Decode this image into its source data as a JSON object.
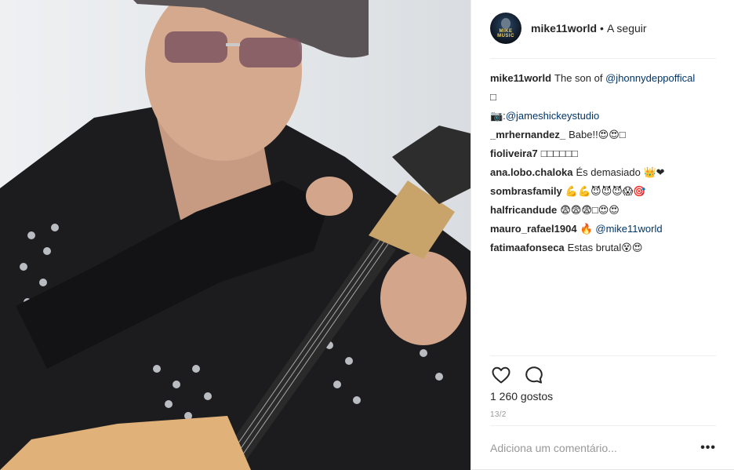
{
  "post": {
    "username": "mike11world",
    "separator": "•",
    "follow_label": "A seguir",
    "avatar_text": "MIKE MUSIC"
  },
  "caption": {
    "user": "mike11world",
    "text": "The son of",
    "mention": "@jhonnydeppoffical",
    "line2": "□",
    "credit_prefix": "📷:",
    "credit_mention": "@jameshickeystudio"
  },
  "comments": [
    {
      "user": "_mrhernandez_",
      "text": "Babe!!😍😍□",
      "mention": ""
    },
    {
      "user": "fioliveira7",
      "text": "□□□□□□",
      "mention": ""
    },
    {
      "user": "ana.lobo.chaloka",
      "text": "És demasiado 👑❤",
      "mention": ""
    },
    {
      "user": "sombrasfamily",
      "text": "💪💪😈😈😈😱🎯",
      "mention": ""
    },
    {
      "user": "halfricandude",
      "text": "😨😨😨□😍😍",
      "mention": ""
    },
    {
      "user": "mauro_rafael1904",
      "text": "🔥",
      "mention": "@mike11world"
    },
    {
      "user": "fatimaafonseca",
      "text": "Estas brutal😵😍",
      "mention": ""
    }
  ],
  "actions": {
    "like_icon": "heart-icon",
    "comment_icon": "comment-bubble-icon"
  },
  "likes_label": "1 260 gostos",
  "date_label": "13/2",
  "add_comment": {
    "placeholder": "Adiciona um comentário...",
    "more_label": "•••"
  },
  "colors": {
    "link": "#003569",
    "text": "#262626",
    "muted": "#999999",
    "divider": "#efefef"
  }
}
